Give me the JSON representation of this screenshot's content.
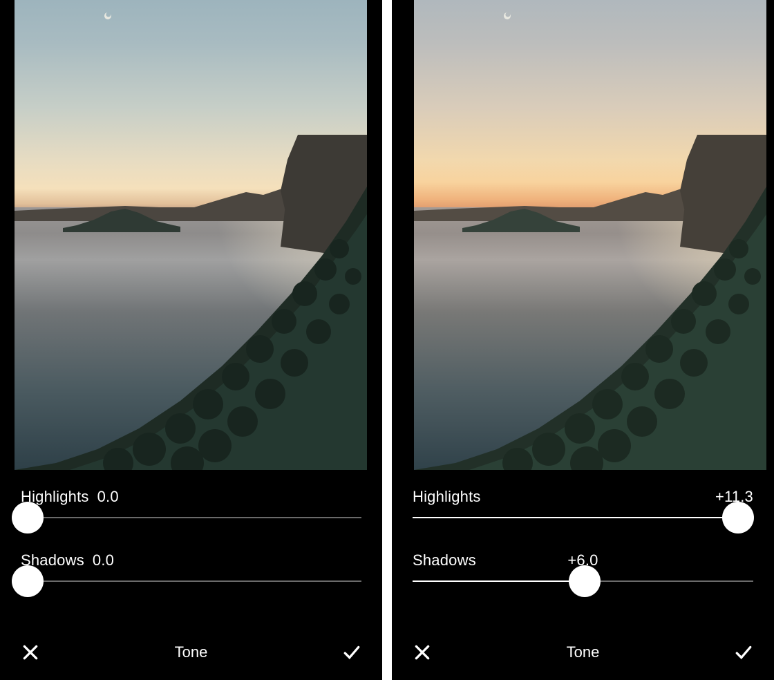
{
  "panels": [
    {
      "highlights": {
        "label": "Highlights",
        "value": "0.0",
        "position_pct": 2,
        "fill_start_pct": 0,
        "fill_end_pct": 2,
        "label_layout": "adjacent"
      },
      "shadows": {
        "label": "Shadows",
        "value": "0.0",
        "position_pct": 2,
        "fill_start_pct": 0,
        "fill_end_pct": 2,
        "label_layout": "adjacent"
      },
      "tool_title": "Tone",
      "cancel_icon": "close-icon",
      "confirm_icon": "check-icon"
    },
    {
      "highlights": {
        "label": "Highlights",
        "value": "+11.3",
        "position_pct": 95.5,
        "fill_start_pct": 0,
        "fill_end_pct": 95.5,
        "label_layout": "spread"
      },
      "shadows": {
        "label": "Shadows",
        "value": "+6.0",
        "position_pct": 50.5,
        "fill_start_pct": 0,
        "fill_end_pct": 50.5,
        "label_layout": "center"
      },
      "tool_title": "Tone",
      "cancel_icon": "close-icon",
      "confirm_icon": "check-icon"
    }
  ],
  "colors": {
    "background": "#000000",
    "text": "#FFFFFF",
    "slider_track": "#6a6a6a",
    "slider_fill": "#FFFFFF",
    "slider_thumb": "#FFFFFF"
  }
}
